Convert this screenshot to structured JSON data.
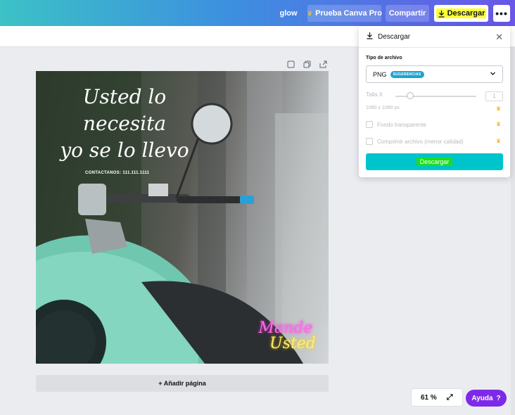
{
  "topbar": {
    "project_name": "glow",
    "pro_label": "Prueba Canva Pro",
    "share_label": "Compartir",
    "download_label": "Descargar",
    "more_label": "•••",
    "gradient_colors": [
      "#3cc2c6",
      "#3d8fe0",
      "#6a56e8"
    ]
  },
  "design": {
    "headline_lines": [
      "Usted lo",
      "necesita",
      "yo se lo llevo"
    ],
    "contact": "CONTACTANOS: 111.111.1111",
    "neon_line1": "Mande",
    "neon_line2": "Usted"
  },
  "add_page_label": "+ Añadir página",
  "zoom": {
    "value": "61 %"
  },
  "help": {
    "label": "Ayuda",
    "icon": "?"
  },
  "download_panel": {
    "title": "Descargar",
    "file_type_label": "Tipo de archivo",
    "file_type_value": "PNG",
    "badge": "SUGERENCIAS",
    "size_label": "Talla X",
    "size_value": "1",
    "dimensions": "1080 x 1080 px",
    "transparent_label": "Fondo transparente",
    "compress_label": "Comprimir archivo (menor calidad)",
    "button_label": "Descargar",
    "accent": "#00c4cc"
  }
}
